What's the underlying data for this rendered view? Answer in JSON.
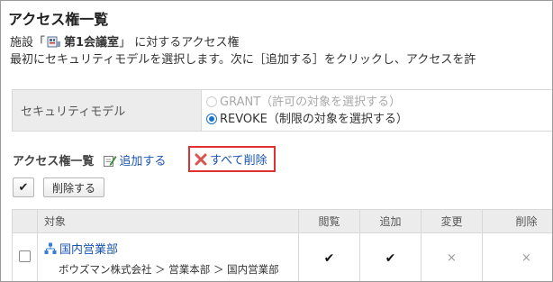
{
  "page": {
    "title": "アクセス権一覧",
    "desc1_prefix": "施設「",
    "facility_name": "第1会議室",
    "desc1_suffix": "」 に対するアクセス権",
    "desc2": "最初にセキュリティモデルを選択します。次に［追加する］をクリックし、アクセスを許"
  },
  "security": {
    "label": "セキュリティモデル",
    "option_grant": "GRANT（許可の対象を選択する）",
    "option_revoke": "REVOKE（制限の対象を選択する）",
    "selected": "REVOKE"
  },
  "list": {
    "title": "アクセス権一覧",
    "add_label": "追加する",
    "delete_all_label": "すべて削除",
    "check_all_label": "✔",
    "delete_label": "削除する"
  },
  "table": {
    "headers": {
      "target": "対象",
      "view": "閲覧",
      "add": "追加",
      "change": "変更",
      "delete": "削除"
    },
    "rows": [
      {
        "name": "国内営業部",
        "path": "ボウズマン株式会社 ＞ 営業本部 ＞ 国内営業部",
        "view": "✔",
        "add": "✔",
        "change": "×",
        "delete": "×"
      }
    ]
  },
  "colors": {
    "link": "#1a55b3",
    "highlight_border": "#e03131",
    "radio_selected": "#1a73c9",
    "delete_icon": "#d9534f"
  },
  "icons": [
    "facility-icon",
    "pencil-icon",
    "x-icon",
    "org-icon",
    "check-icon",
    "cross-icon"
  ]
}
